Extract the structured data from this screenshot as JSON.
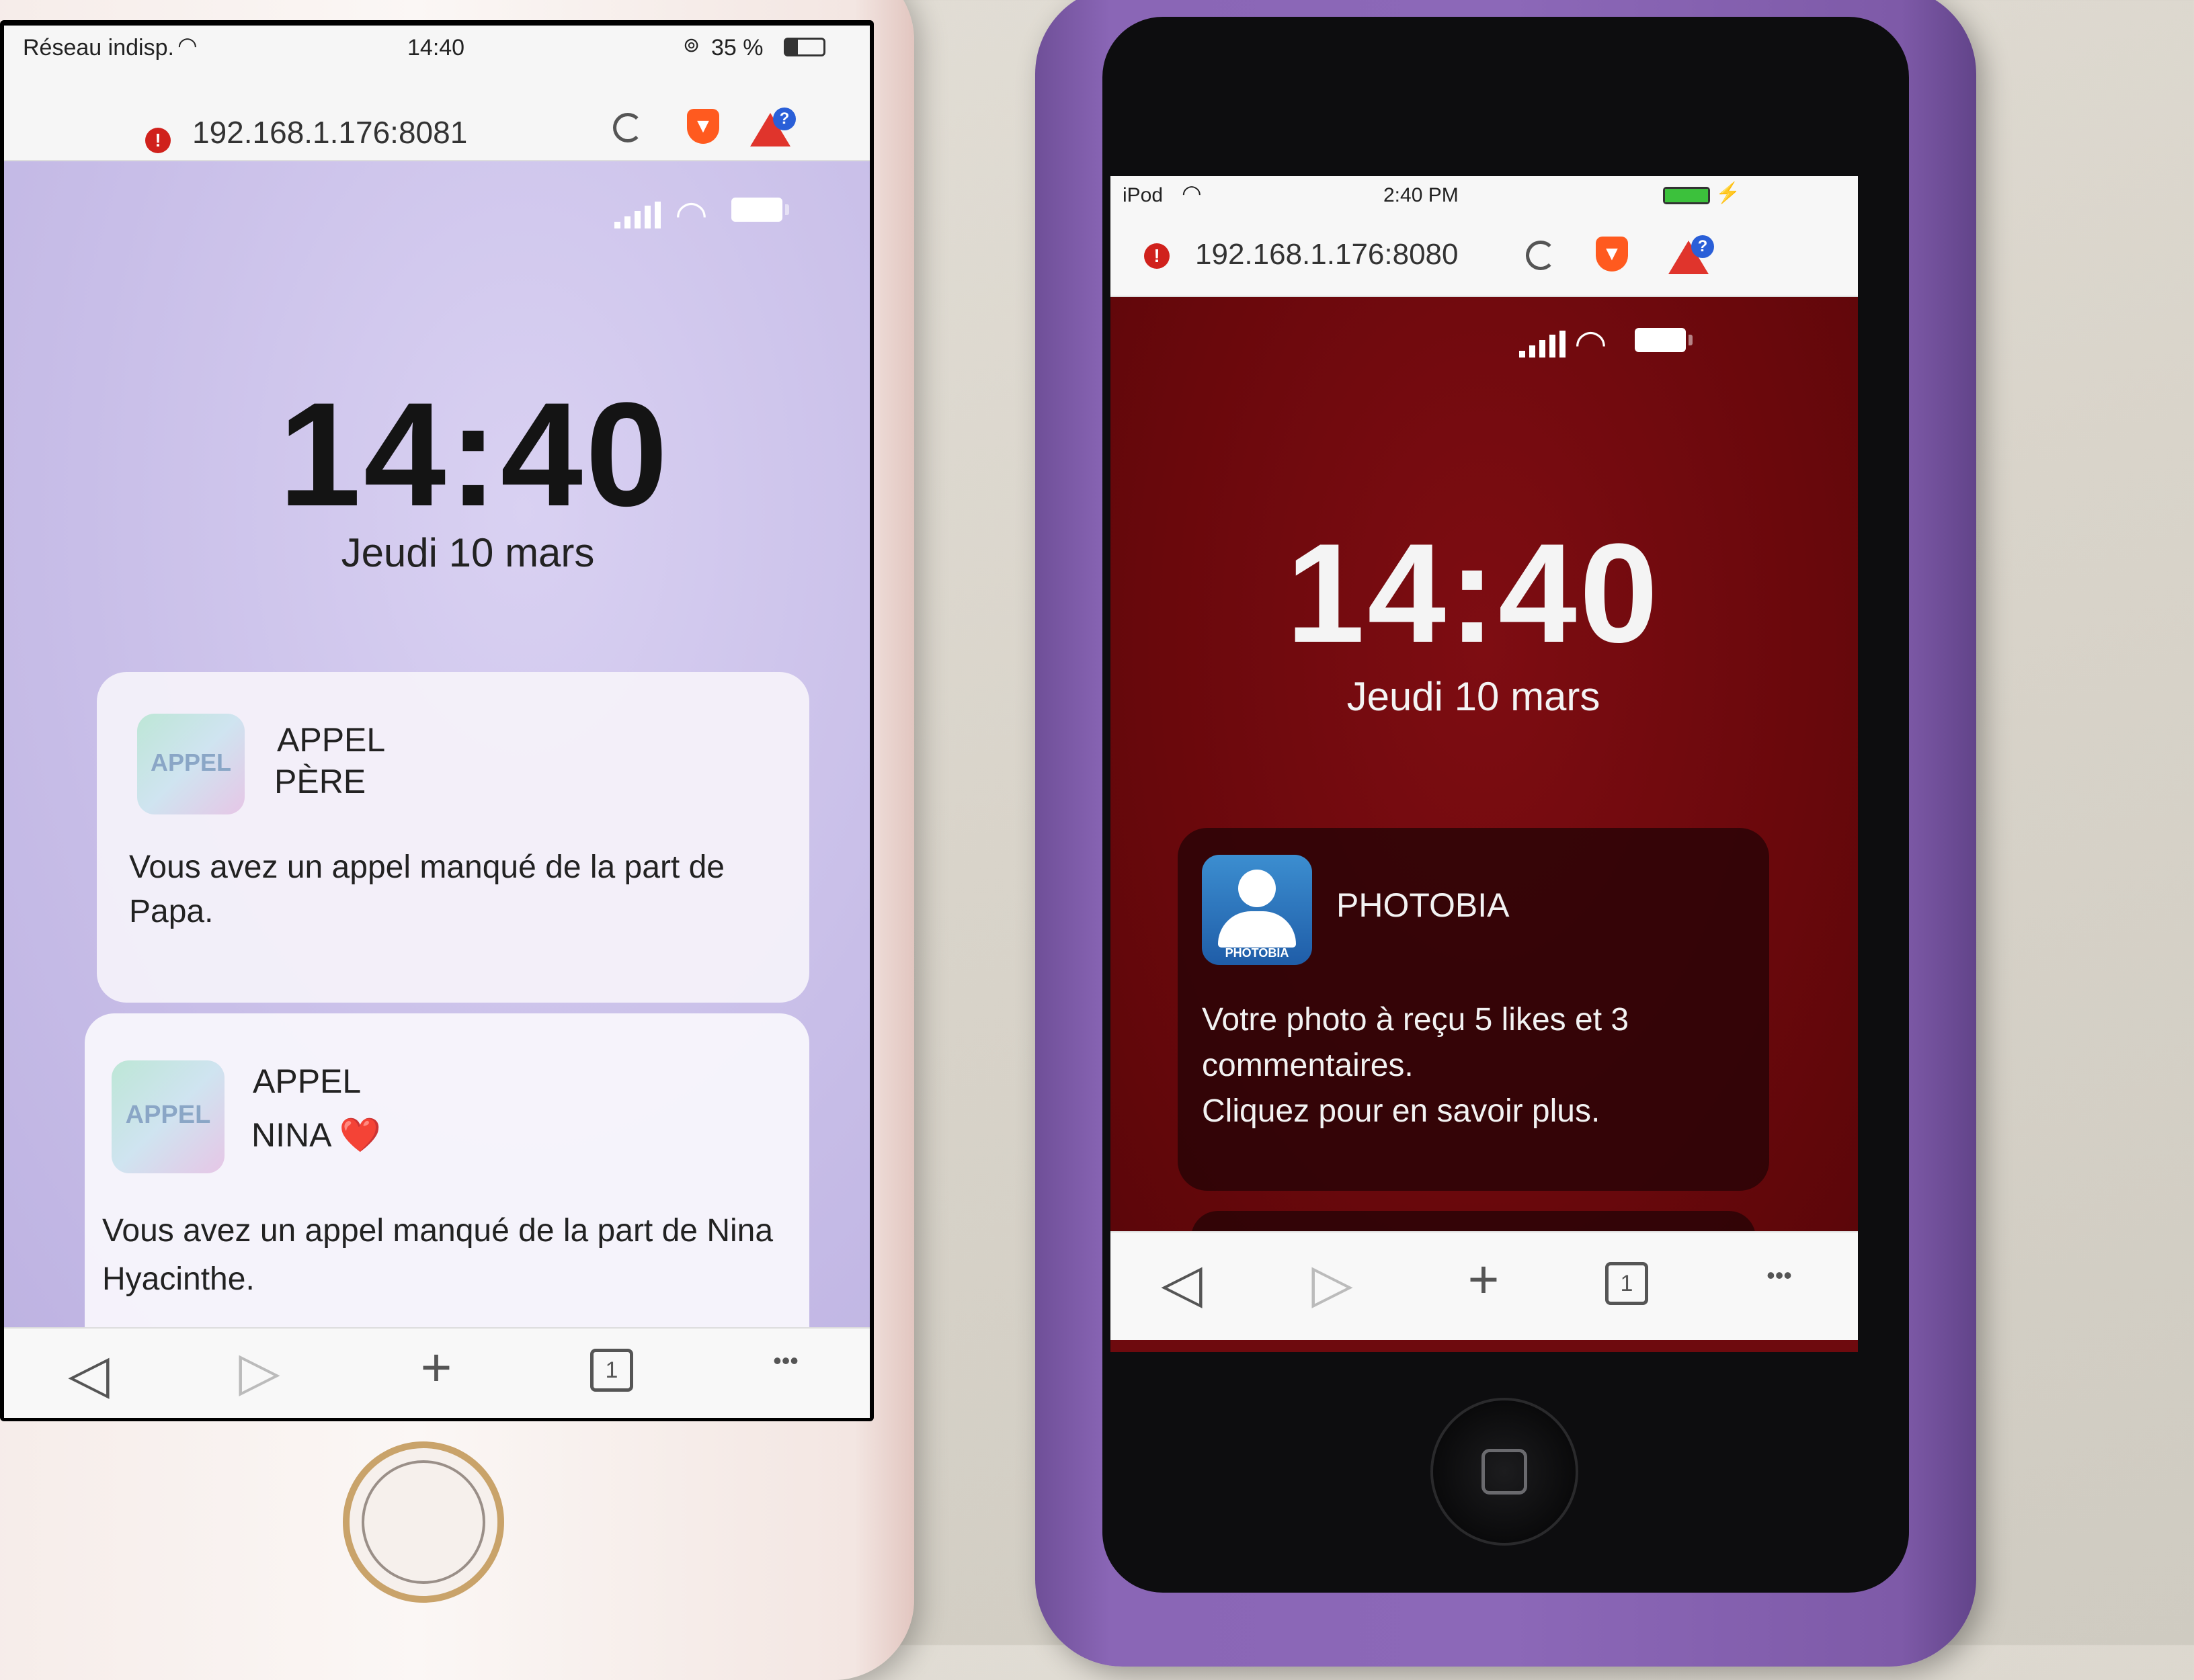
{
  "left_phone": {
    "status_bar": {
      "carrier": "Réseau indisp.",
      "time": "14:40",
      "battery": "35 %"
    },
    "url_bar": {
      "url": "192.168.1.176:8081"
    },
    "lock_screen": {
      "clock": "14:40",
      "date": "Jeudi 10 mars"
    },
    "notifications": [
      {
        "icon_label": "APPEL",
        "title_line1": "APPEL",
        "title_line2": "PÈRE",
        "emoji": "",
        "body": "Vous avez un appel manqué de la part de Papa."
      },
      {
        "icon_label": "APPEL",
        "title_line1": "APPEL",
        "title_line2": "NINA",
        "emoji": "❤️",
        "body": "Vous avez un appel manqué de la part de Nina Hyacinthe."
      }
    ],
    "toolbar": {
      "back": "◁",
      "forward": "▷",
      "add": "+",
      "tabs": "1",
      "more": "•••"
    }
  },
  "right_phone": {
    "status_bar": {
      "device": "iPod",
      "time": "2:40 PM"
    },
    "url_bar": {
      "url": "192.168.1.176:8080"
    },
    "lock_screen": {
      "clock": "14:40",
      "date": "Jeudi 10 mars"
    },
    "notification": {
      "icon_label": "PHOTOBIA",
      "title": "PHOTOBIA",
      "body_line1": "Votre photo à reçu 5 likes et 3",
      "body_line2": "commentaires.",
      "body_line3": "Cliquez pour en savoir plus."
    },
    "toolbar": {
      "back": "◁",
      "forward": "▷",
      "add": "+",
      "tabs": "1",
      "more": "•••"
    }
  },
  "colors": {
    "left_wallpaper": "#c8bee8",
    "right_wallpaper": "#6e0a0e",
    "case_purple": "#8a66b6",
    "alert_red": "#d0211c"
  }
}
